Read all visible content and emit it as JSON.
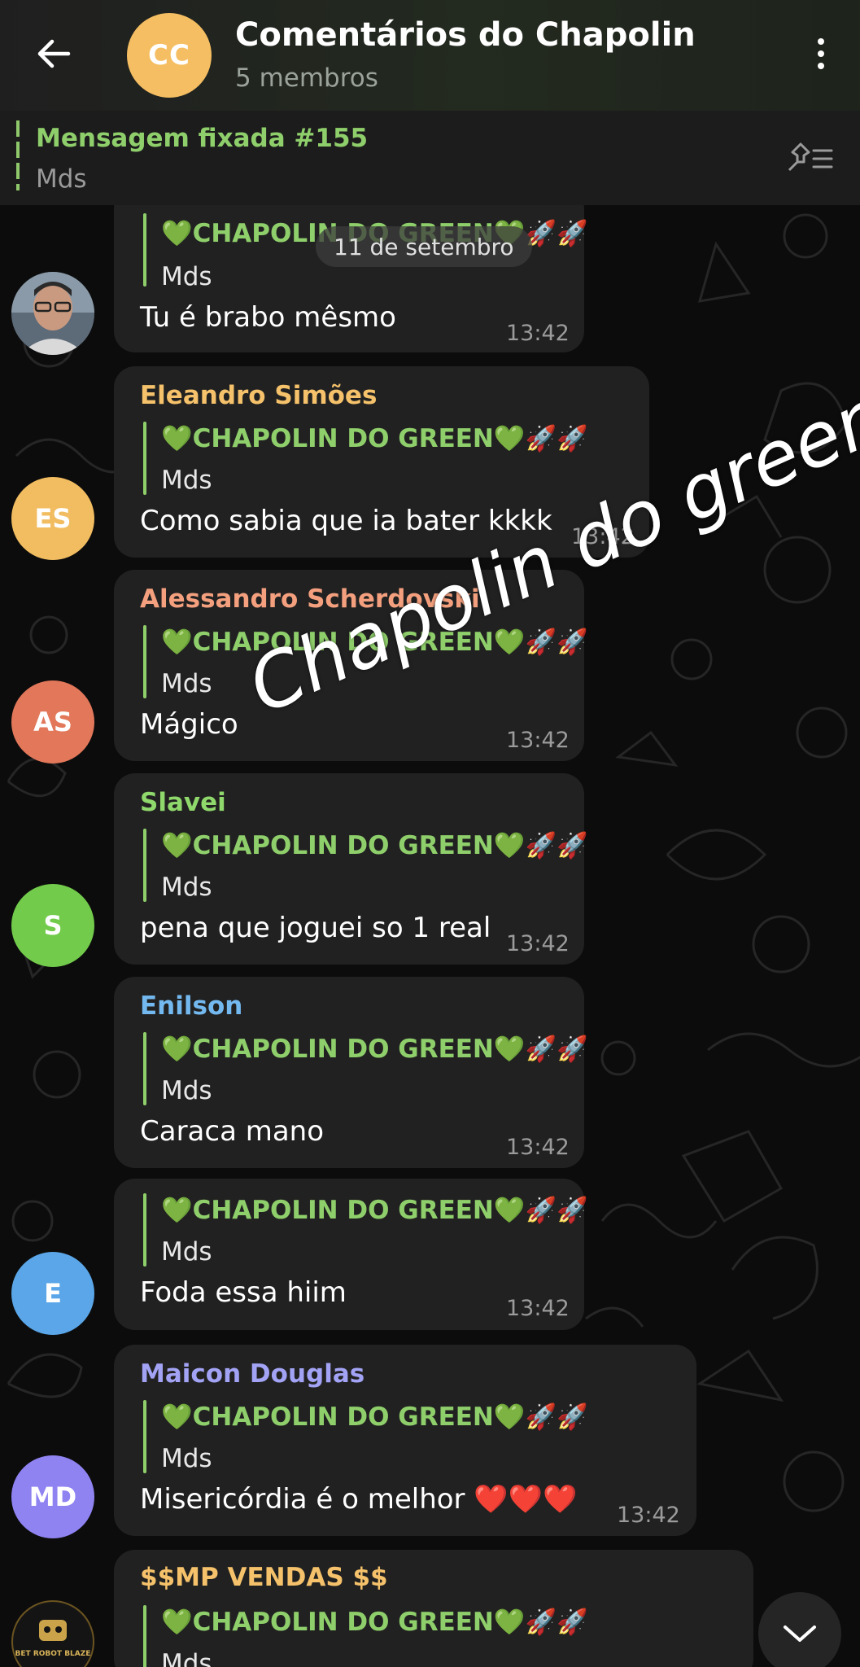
{
  "header": {
    "title": "Comentários do Chapolin",
    "subtitle": "5 membros",
    "avatar_initials": "CC",
    "avatar_color": "#f5be62"
  },
  "pinned": {
    "title": "Mensagem fixada #155",
    "text": "Mds"
  },
  "date_chip": "11 de setembro",
  "watermark": "Chapolin do green",
  "reply": {
    "title": "💚CHAPOLIN DO GREEN💚🚀🚀",
    "text": "Mds"
  },
  "messages": [
    {
      "sender": "",
      "sender_color": "",
      "text": "Tu é brabo mêsmo",
      "time": "13:42",
      "avatar": "photo"
    },
    {
      "sender": "Eleandro Simões",
      "sender_color": "#f5c26b",
      "text": "Como sabia que ia bater kkkk",
      "time": "13:42",
      "avatar_initials": "ES",
      "avatar_color": "#f2bd61"
    },
    {
      "sender": "Alessandro Scherdovski",
      "sender_color": "#f4a07e",
      "text": "Mágico",
      "time": "13:42",
      "avatar_initials": "AS",
      "avatar_color": "#e2775a"
    },
    {
      "sender": "Slavei",
      "sender_color": "#8fd86b",
      "text": "pena que joguei so 1 real",
      "time": "13:42",
      "avatar_initials": "S",
      "avatar_color": "#72cb4b"
    },
    {
      "sender": "Enilson",
      "sender_color": "#73b9f0",
      "text": "Caraca mano",
      "time": "13:42",
      "avatar_initials": "",
      "avatar_color": ""
    },
    {
      "sender": "",
      "sender_color": "",
      "text": "Foda essa hiim",
      "time": "13:42",
      "avatar_initials": "E",
      "avatar_color": "#5aa6e8"
    },
    {
      "sender": "Maicon Douglas",
      "sender_color": "#a2a3f5",
      "text": "Misericórdia é o melhor ❤️❤️❤️",
      "time": "13:42",
      "avatar_initials": "MD",
      "avatar_color": "#8f83f2"
    },
    {
      "sender": "$$MP VENDAS $$",
      "sender_color": "#f5c26b",
      "text": "",
      "time": "",
      "avatar": "logo",
      "avatar_text": "BET ROBOT BLAZE"
    }
  ]
}
